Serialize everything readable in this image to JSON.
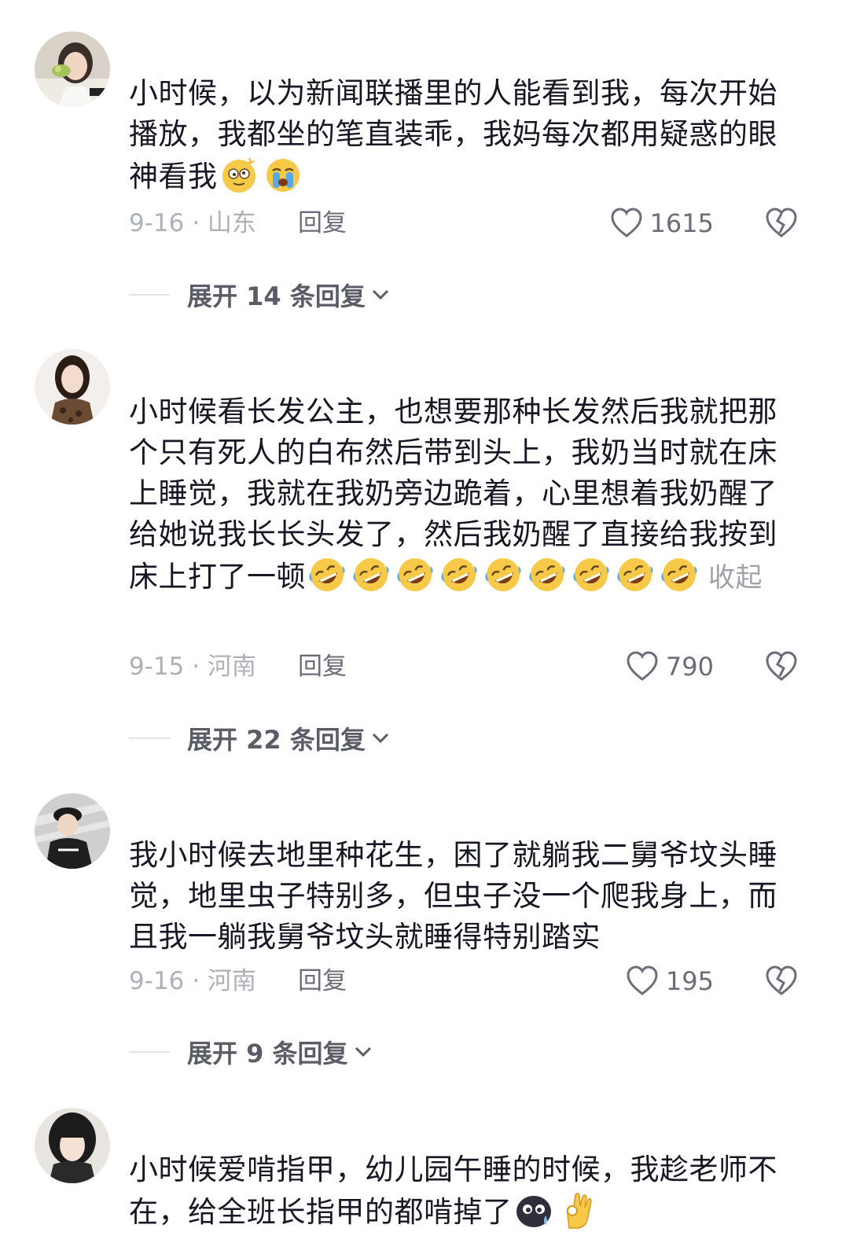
{
  "comments": [
    {
      "text": "小时候，以为新闻联播里的人能看到我，每次开始播放，我都坐的笔直装乖，我妈每次都用疑惑的眼神看我",
      "emojis": [
        "dizzy-face-emoji",
        "crying-face-emoji"
      ],
      "date_location": "9-16 · 山东",
      "reply_label": "回复",
      "like_count": "1615",
      "expand_label": "展开 14 条回复"
    },
    {
      "text": "小时候看长发公主，也想要那种长发然后我就把那个只有死人的白布然后带到头上，我奶当时就在床上睡觉，我就在我奶旁边跪着，心里想着我奶醒了给她说我长长头发了，然后我奶醒了直接给我按到床上打了一顿",
      "emojis": [
        "rofl-emoji",
        "rofl-emoji",
        "rofl-emoji",
        "rofl-emoji",
        "rofl-emoji",
        "rofl-emoji",
        "rofl-emoji",
        "rofl-emoji",
        "rofl-emoji"
      ],
      "collapse_label": "收起",
      "date_location": "9-15 · 河南",
      "reply_label": "回复",
      "like_count": "790",
      "expand_label": "展开 22 条回复"
    },
    {
      "text": "我小时候去地里种花生，困了就躺我二舅爷坟头睡觉，地里虫子特别多，但虫子没一个爬我身上，而且我一躺我舅爷坟头就睡得特别踏实",
      "date_location": "9-16 · 河南",
      "reply_label": "回复",
      "like_count": "195",
      "expand_label": "展开 9 条回复"
    },
    {
      "text": "小时候爱啃指甲，幼儿园午睡的时候，我趁老师不在，给全班长指甲的都啃掉了",
      "emojis": [
        "sad-blob-emoji",
        "ok-hand-emoji"
      ]
    }
  ],
  "colors": {
    "text": "#161823",
    "meta": "#b0b0b8",
    "secondary": "#6b6e78",
    "collapse": "#a0a0a8",
    "divider": "#e3e3e6"
  }
}
